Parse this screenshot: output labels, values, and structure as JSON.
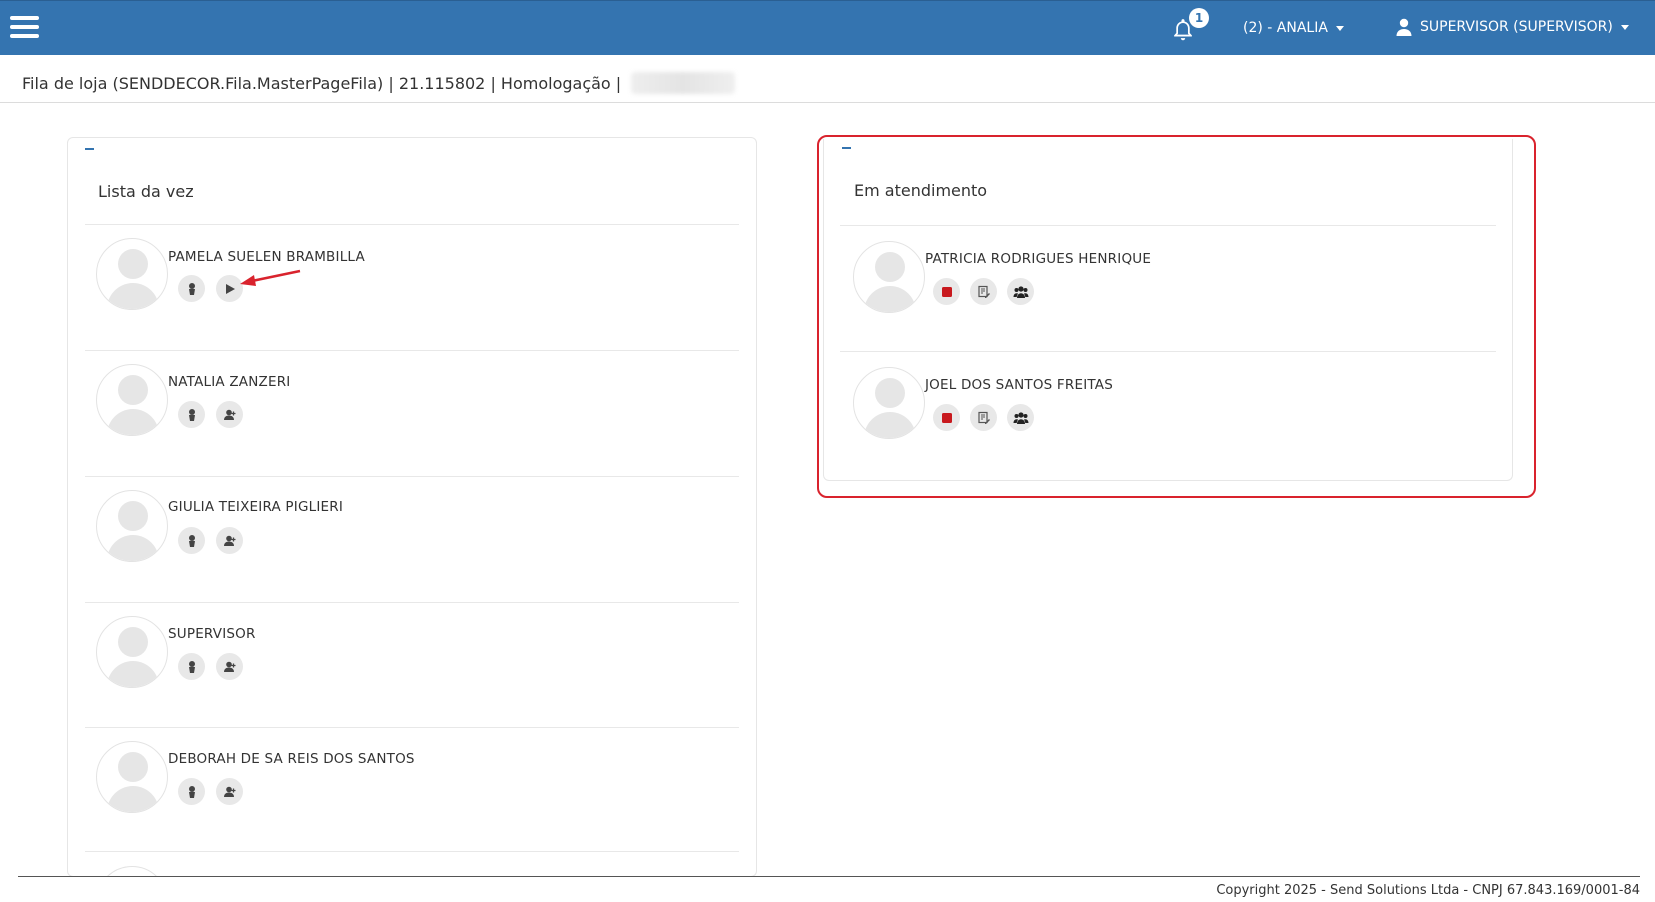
{
  "header": {
    "notification_count": "1",
    "store_label": "(2) - ANALIA",
    "user_label": "SUPERVISOR (SUPERVISOR)"
  },
  "breadcrumb": {
    "text": "Fila de loja (SENDDECOR.Fila.MasterPageFila) | 21.115802 | Homologação |"
  },
  "queue": {
    "title": "Lista da vez",
    "collapse_label": "–",
    "people": [
      {
        "name": "PAMELA SUELEN BRAMBILLA",
        "actions": [
          "client-icon",
          "play-icon"
        ]
      },
      {
        "name": "NATALIA ZANZERI",
        "actions": [
          "client-icon",
          "user-add-icon"
        ]
      },
      {
        "name": "GIULIA TEIXEIRA PIGLIERI",
        "actions": [
          "client-icon",
          "user-add-icon"
        ]
      },
      {
        "name": "SUPERVISOR",
        "actions": [
          "client-icon",
          "user-add-icon"
        ]
      },
      {
        "name": "DEBORAH DE SA REIS DOS SANTOS",
        "actions": [
          "client-icon",
          "user-add-icon"
        ]
      }
    ]
  },
  "attending": {
    "title": "Em atendimento",
    "collapse_label": "–",
    "people": [
      {
        "name": "PATRICIA RODRIGUES HENRIQUE",
        "actions": [
          "stop-icon",
          "edit-note-icon",
          "group-icon"
        ]
      },
      {
        "name": "JOEL DOS SANTOS FREITAS",
        "actions": [
          "stop-icon",
          "edit-note-icon",
          "group-icon"
        ]
      }
    ]
  },
  "footer": {
    "copyright": "Copyright 2025 - Send Solutions Ltda - CNPJ 67.843.169/0001-84"
  },
  "colors": {
    "primary": "#3474b0",
    "highlight": "#d9232d",
    "stop": "#c8191e"
  }
}
